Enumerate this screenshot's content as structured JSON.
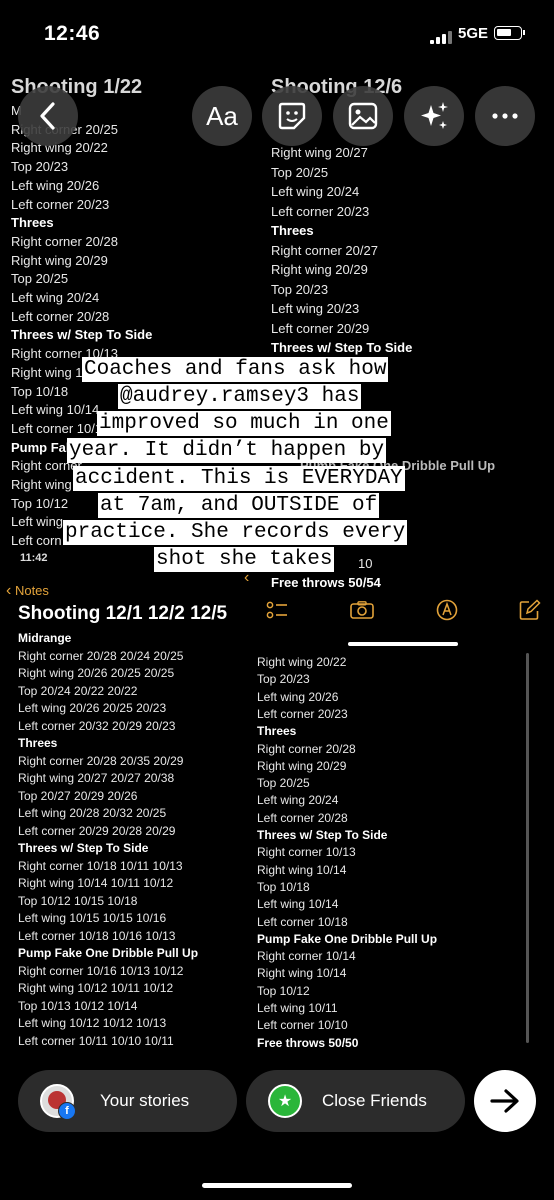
{
  "status": {
    "time": "12:46",
    "carrier": "5GE"
  },
  "toolbar": {
    "text_label": "Aa"
  },
  "note_left": {
    "title": "Shooting 1/22",
    "lines": [
      {
        "t": "M",
        "b": false
      },
      {
        "t": "Right corner 20/25",
        "b": false
      },
      {
        "t": "Right wing 20/22",
        "b": false
      },
      {
        "t": "Top 20/23",
        "b": false
      },
      {
        "t": "Left wing 20/26",
        "b": false
      },
      {
        "t": "Left corner 20/23",
        "b": false
      },
      {
        "t": "Threes",
        "b": true
      },
      {
        "t": "Right corner 20/28",
        "b": false
      },
      {
        "t": "Right wing 20/29",
        "b": false
      },
      {
        "t": "Top 20/25",
        "b": false
      },
      {
        "t": "Left wing 20/24",
        "b": false
      },
      {
        "t": "Left corner 20/28",
        "b": false
      },
      {
        "t": "Threes w/ Step To Side",
        "b": true
      },
      {
        "t": "Right corner 10/13",
        "b": false
      },
      {
        "t": "Right wing 10/14",
        "b": false
      },
      {
        "t": "Top 10/18",
        "b": false
      },
      {
        "t": "Left wing 10/14",
        "b": false
      },
      {
        "t": "Left corner 10/18",
        "b": false
      },
      {
        "t": "Pump Fake",
        "b": true
      },
      {
        "t": "Right corner",
        "b": false
      },
      {
        "t": "Right wing",
        "b": false
      },
      {
        "t": "Top 10/12",
        "b": false
      },
      {
        "t": "Left wing",
        "b": false
      },
      {
        "t": "Left corn",
        "b": false
      }
    ]
  },
  "note_right": {
    "title": "Shooting 12/6",
    "lines": [
      {
        "t": "Right wing 20/27",
        "b": false
      },
      {
        "t": "Top 20/25",
        "b": false
      },
      {
        "t": "Left wing 20/24",
        "b": false
      },
      {
        "t": "Left corner 20/23",
        "b": false
      },
      {
        "t": "Threes",
        "b": true
      },
      {
        "t": "Right corner 20/27",
        "b": false
      },
      {
        "t": "Right wing 20/29",
        "b": false
      },
      {
        "t": "Top 20/23",
        "b": false
      },
      {
        "t": "Left wing 20/23",
        "b": false
      },
      {
        "t": "Left corner 20/29",
        "b": false
      },
      {
        "t": "Threes w/ Step To Side",
        "b": true
      }
    ],
    "partial": "Pump Fake One Dribble Pull Up",
    "partial_2": "10",
    "free_throws": "Free throws 50/54"
  },
  "caption": [
    "Coaches and fans ask how",
    "@audrey.ramsey3 has",
    "improved so much in one",
    "year. It didn’t happen by",
    "accident. This is EVERYDAY",
    "at 7am, and OUTSIDE of",
    "practice. She records every",
    "shot she takes"
  ],
  "mid": {
    "time": "11:42",
    "back_label": "Notes"
  },
  "note_bottom_left": {
    "title": "Shooting 12/1 12/2 12/5",
    "lines": [
      {
        "t": "Midrange",
        "b": true
      },
      {
        "t": "Right corner 20/28 20/24 20/25",
        "b": false
      },
      {
        "t": "Right wing 20/26 20/25 20/25",
        "b": false
      },
      {
        "t": "Top 20/24 20/22 20/22",
        "b": false
      },
      {
        "t": "Left wing 20/26 20/25 20/23",
        "b": false
      },
      {
        "t": "Left corner 20/32 20/29 20/23",
        "b": false
      },
      {
        "t": "Threes",
        "b": true
      },
      {
        "t": "Right corner 20/28 20/35 20/29",
        "b": false
      },
      {
        "t": "Right wing 20/27 20/27 20/38",
        "b": false
      },
      {
        "t": "Top 20/27 20/29 20/26",
        "b": false
      },
      {
        "t": "Left wing 20/28 20/32 20/25",
        "b": false
      },
      {
        "t": "Left corner 20/29 20/28 20/29",
        "b": false
      },
      {
        "t": "Threes w/ Step To Side",
        "b": true
      },
      {
        "t": "Right corner 10/18 10/11 10/13",
        "b": false
      },
      {
        "t": "Right wing 10/14 10/11 10/12",
        "b": false
      },
      {
        "t": "Top 10/12 10/15 10/18",
        "b": false
      },
      {
        "t": "Left wing 10/15 10/15 10/16",
        "b": false
      },
      {
        "t": "Left corner 10/18 10/16 10/13",
        "b": false
      },
      {
        "t": "Pump Fake One Dribble Pull Up",
        "b": true
      },
      {
        "t": "Right corner 10/16 10/13 10/12",
        "b": false
      },
      {
        "t": "Right wing 10/12 10/11 10/12",
        "b": false
      },
      {
        "t": "Top 10/13 10/12 10/14",
        "b": false
      },
      {
        "t": "Left wing 10/12 10/12 10/13",
        "b": false
      },
      {
        "t": "Left corner 10/11 10/10 10/11",
        "b": false
      }
    ]
  },
  "note_bottom_right": {
    "lines": [
      {
        "t": "Right wing 20/22",
        "b": false
      },
      {
        "t": "Top 20/23",
        "b": false
      },
      {
        "t": "Left wing 20/26",
        "b": false
      },
      {
        "t": "Left corner 20/23",
        "b": false
      },
      {
        "t": "Threes",
        "b": true
      },
      {
        "t": "Right corner 20/28",
        "b": false
      },
      {
        "t": "Right wing 20/29",
        "b": false
      },
      {
        "t": "Top 20/25",
        "b": false
      },
      {
        "t": "Left wing 20/24",
        "b": false
      },
      {
        "t": "Left corner 20/28",
        "b": false
      },
      {
        "t": "Threes w/ Step To Side",
        "b": true
      },
      {
        "t": "Right corner 10/13",
        "b": false
      },
      {
        "t": "Right wing 10/14",
        "b": false
      },
      {
        "t": "Top 10/18",
        "b": false
      },
      {
        "t": "Left wing 10/14",
        "b": false
      },
      {
        "t": "Left corner 10/18",
        "b": false
      },
      {
        "t": "Pump Fake One Dribble Pull Up",
        "b": true
      },
      {
        "t": "Right corner 10/14",
        "b": false
      },
      {
        "t": "Right wing 10/14",
        "b": false
      },
      {
        "t": "Top 10/12",
        "b": false
      },
      {
        "t": "Left wing 10/11",
        "b": false
      },
      {
        "t": "Left corner 10/10",
        "b": false
      },
      {
        "t": "Free throws 50/50",
        "b": true
      }
    ]
  },
  "bottom": {
    "your_stories": "Your stories",
    "close_friends": "Close Friends"
  },
  "colors": {
    "notes_accent": "#e3a33a",
    "close_friends_green": "#2ab63a"
  }
}
